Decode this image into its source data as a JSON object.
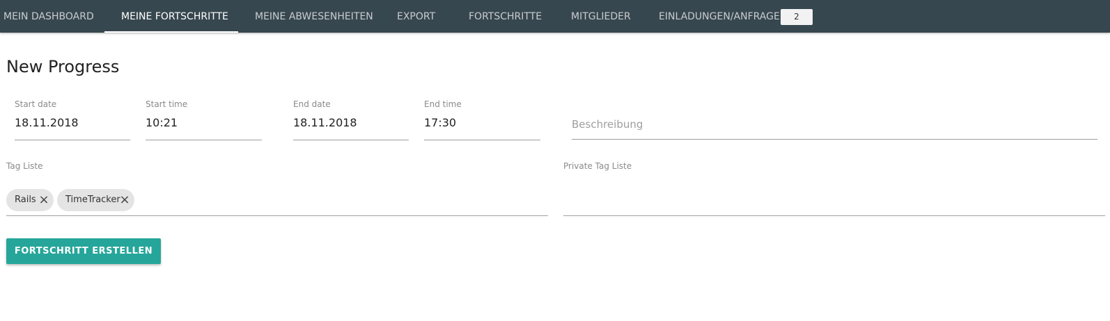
{
  "nav": {
    "tabs": [
      {
        "label": "Mein Dashboard"
      },
      {
        "label": "Meine Fortschritte",
        "active": true
      },
      {
        "label": "Meine Abwesenheiten"
      },
      {
        "label": "Export"
      },
      {
        "label": "Fortschritte"
      },
      {
        "label": "Mitglieder"
      },
      {
        "label": "Einladungen/Anfragen"
      }
    ],
    "badge": "2"
  },
  "page": {
    "title": "New Progress"
  },
  "form": {
    "start_date": {
      "label": "Start date",
      "value": "18.11.2018"
    },
    "start_time": {
      "label": "Start time",
      "value": "10:21"
    },
    "end_date": {
      "label": "End date",
      "value": "18.11.2018"
    },
    "end_time": {
      "label": "End time",
      "value": "17:30"
    },
    "description": {
      "placeholder": "Beschreibung"
    },
    "tag_list": {
      "label": "Tag Liste",
      "tags": [
        {
          "label": "Rails",
          "close_icon": "close-icon"
        },
        {
          "label": "TimeTracker",
          "close_icon": "close-icon"
        }
      ]
    },
    "private_tag_list": {
      "label": "Private Tag Liste"
    },
    "submit_label": "Fortschritt erstellen"
  },
  "colors": {
    "nav_background": "#37474f",
    "accent": "#26a69a"
  }
}
